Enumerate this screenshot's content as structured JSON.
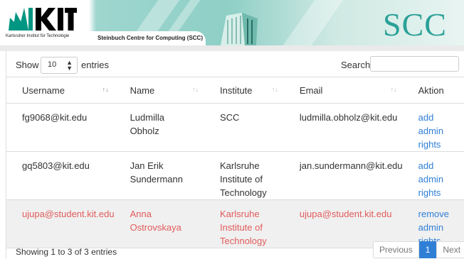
{
  "header": {
    "kit_subtitle": "Karlsruher Institut für Technologie",
    "centre_name": "Steinbuch Centre for Computing (SCC)",
    "scc_logo": "SCC",
    "kit_logo": "KIT"
  },
  "controls": {
    "show_label": "Show",
    "entries_label": "entries",
    "length_value": "10",
    "search_label": "Search:",
    "search_value": ""
  },
  "table": {
    "columns": [
      "Username",
      "Name",
      "Institute",
      "Email",
      "Aktion"
    ],
    "rows": [
      {
        "username": "fg9068@kit.edu",
        "name": "Ludmilla Obholz",
        "institute": "SCC",
        "email": "ludmilla.obholz@kit.edu",
        "action": "add admin rights"
      },
      {
        "username": "gq5803@kit.edu",
        "name": "Jan Erik Sundermann",
        "institute": "Karlsruhe Institute of Technology",
        "email": "jan.sundermann@kit.edu",
        "action": "add admin rights"
      },
      {
        "username": "ujupa@student.kit.edu",
        "name": "Anna Ostrovskaya",
        "institute": "Karlsruhe Institute of Technology",
        "email": "ujupa@student.kit.edu",
        "action": "remove admin rights"
      }
    ]
  },
  "footer": {
    "info": "Showing 1 to 3 of 3 entries",
    "previous": "Previous",
    "current_page": "1",
    "next": "Next"
  },
  "colors": {
    "link": "#2f7fd6",
    "admin_row_text": "#e15b5b",
    "teal": "#2aa198"
  }
}
